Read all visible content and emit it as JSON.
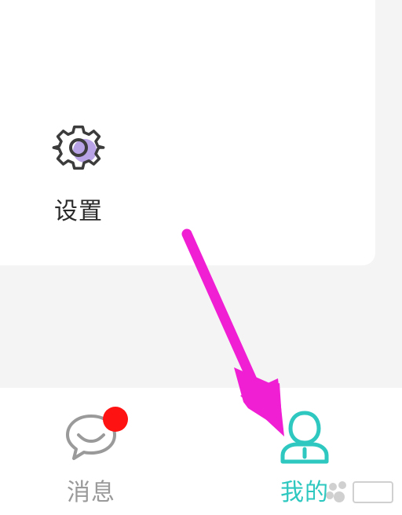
{
  "settings": {
    "label": "设置",
    "icon": "gear-icon"
  },
  "tabbar": {
    "messages": {
      "label": "消息",
      "icon": "chat-bubble-icon",
      "has_unread_badge": true
    },
    "me": {
      "label": "我的",
      "icon": "user-icon",
      "active": true
    }
  },
  "colors": {
    "active_tab": "#2ec8c0",
    "inactive_tab": "#9a9a9a",
    "badge": "#ff1212",
    "gear_accent": "#b8a3e6",
    "annotation_arrow": "#f01fd4"
  }
}
